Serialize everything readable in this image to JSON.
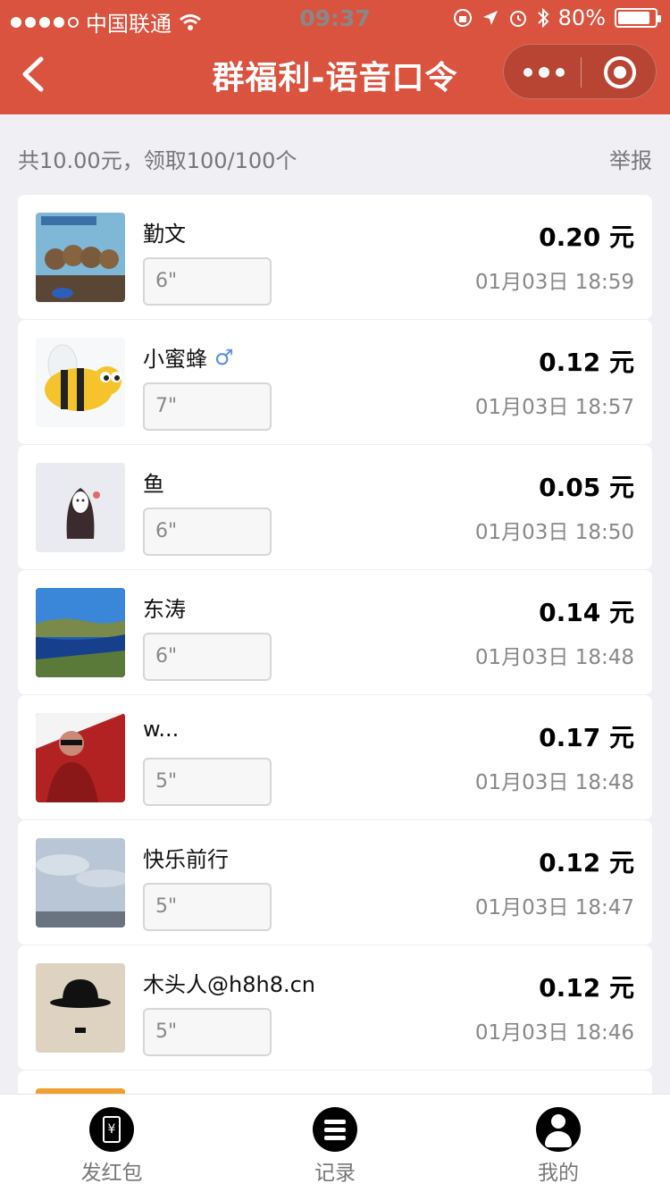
{
  "status_bar": {
    "carrier": "中国联通",
    "time": "09:37",
    "battery": "80%"
  },
  "header": {
    "title": "群福利-语音口令"
  },
  "summary": {
    "text": "共10.00元，领取100/100个",
    "report": "举报"
  },
  "records": [
    {
      "name": "勤文",
      "gender_icon": "",
      "duration": "6\"",
      "amount": "0.20 元",
      "time": "01月03日 18:59",
      "avatar": "otter-photo"
    },
    {
      "name": "小蜜蜂",
      "gender_icon": "♂",
      "duration": "7\"",
      "amount": "0.12 元",
      "time": "01月03日 18:57",
      "avatar": "bee-cartoon"
    },
    {
      "name": "鱼",
      "gender_icon": "",
      "duration": "6\"",
      "amount": "0.05 元",
      "time": "01月03日 18:50",
      "avatar": "no-face-figure"
    },
    {
      "name": "东涛",
      "gender_icon": "",
      "duration": "6\"",
      "amount": "0.14 元",
      "time": "01月03日 18:48",
      "avatar": "river-landscape"
    },
    {
      "name": "w...",
      "gender_icon": "",
      "duration": "5\"",
      "amount": "0.17 元",
      "time": "01月03日 18:48",
      "avatar": "man-red-background"
    },
    {
      "name": "快乐前行",
      "gender_icon": "",
      "duration": "5\"",
      "amount": "0.12 元",
      "time": "01月03日 18:47",
      "avatar": "sky-sea"
    },
    {
      "name": "木头人@h8h8.cn",
      "gender_icon": "",
      "duration": "5\"",
      "amount": "0.12 元",
      "time": "01月03日 18:46",
      "avatar": "bowler-hat"
    }
  ],
  "tabbar": {
    "send": "发红包",
    "records": "记录",
    "mine": "我的"
  },
  "colors": {
    "header": "#d9533f",
    "background": "#efeff4"
  }
}
